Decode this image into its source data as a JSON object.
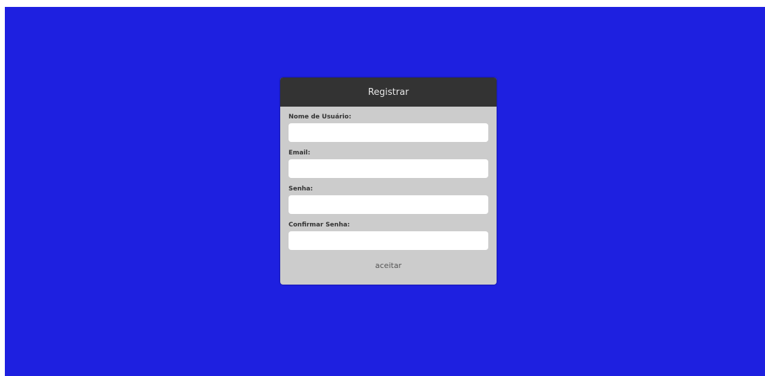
{
  "colors": {
    "background": "#1e20e0",
    "card": "#cccccc",
    "header": "#333333"
  },
  "form": {
    "title": "Registrar",
    "fields": [
      {
        "label": "Nome de Usuário:",
        "value": ""
      },
      {
        "label": "Email:",
        "value": ""
      },
      {
        "label": "Senha:",
        "value": ""
      },
      {
        "label": "Confirmar Senha:",
        "value": ""
      }
    ],
    "submit_label": "aceitar"
  }
}
